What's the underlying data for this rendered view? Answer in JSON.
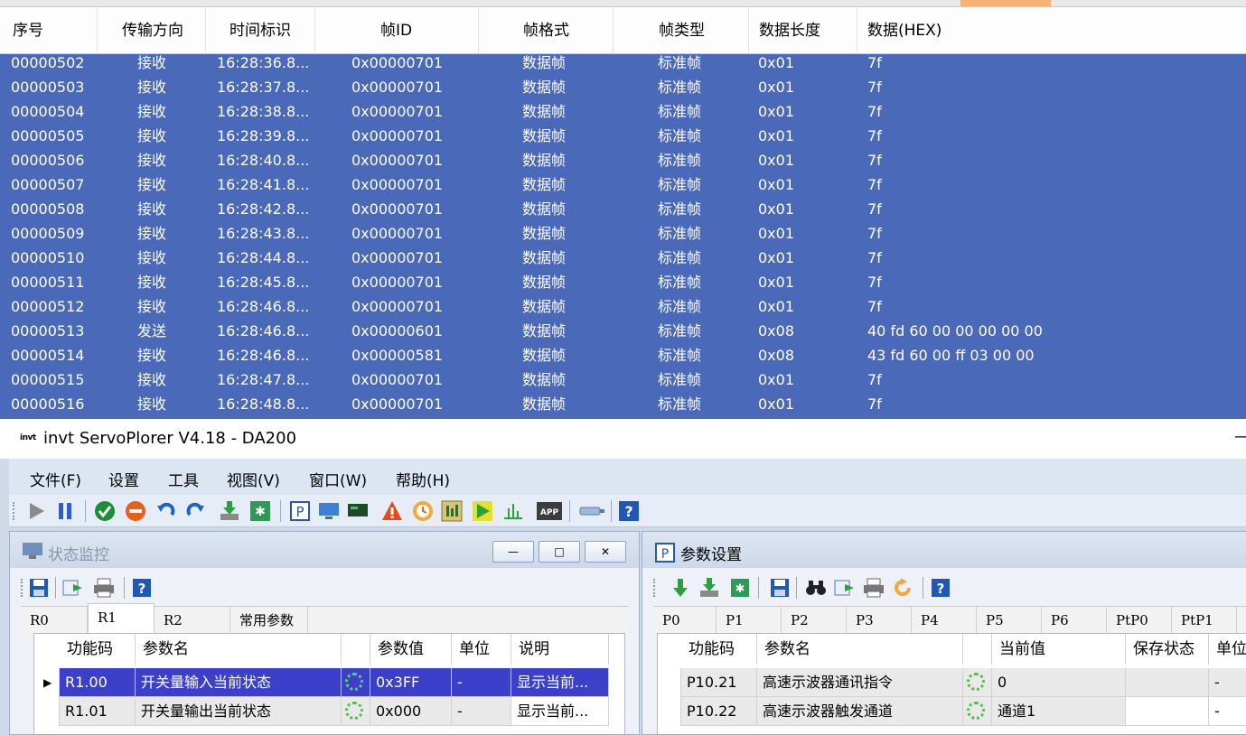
{
  "can_table": {
    "columns": [
      "序号",
      "传输方向",
      "时间标识",
      "帧ID",
      "帧格式",
      "帧类型",
      "数据长度",
      "数据(HEX)"
    ],
    "rows": [
      [
        "00000502",
        "接收",
        "16:28:36.8...",
        "0x00000701",
        "数据帧",
        "标准帧",
        "0x01",
        "7f"
      ],
      [
        "00000503",
        "接收",
        "16:28:37.8...",
        "0x00000701",
        "数据帧",
        "标准帧",
        "0x01",
        "7f"
      ],
      [
        "00000504",
        "接收",
        "16:28:38.8...",
        "0x00000701",
        "数据帧",
        "标准帧",
        "0x01",
        "7f"
      ],
      [
        "00000505",
        "接收",
        "16:28:39.8...",
        "0x00000701",
        "数据帧",
        "标准帧",
        "0x01",
        "7f"
      ],
      [
        "00000506",
        "接收",
        "16:28:40.8...",
        "0x00000701",
        "数据帧",
        "标准帧",
        "0x01",
        "7f"
      ],
      [
        "00000507",
        "接收",
        "16:28:41.8...",
        "0x00000701",
        "数据帧",
        "标准帧",
        "0x01",
        "7f"
      ],
      [
        "00000508",
        "接收",
        "16:28:42.8...",
        "0x00000701",
        "数据帧",
        "标准帧",
        "0x01",
        "7f"
      ],
      [
        "00000509",
        "接收",
        "16:28:43.8...",
        "0x00000701",
        "数据帧",
        "标准帧",
        "0x01",
        "7f"
      ],
      [
        "00000510",
        "接收",
        "16:28:44.8...",
        "0x00000701",
        "数据帧",
        "标准帧",
        "0x01",
        "7f"
      ],
      [
        "00000511",
        "接收",
        "16:28:45.8...",
        "0x00000701",
        "数据帧",
        "标准帧",
        "0x01",
        "7f"
      ],
      [
        "00000512",
        "接收",
        "16:28:46.8...",
        "0x00000701",
        "数据帧",
        "标准帧",
        "0x01",
        "7f"
      ],
      [
        "00000513",
        "发送",
        "16:28:46.8...",
        "0x00000601",
        "数据帧",
        "标准帧",
        "0x08",
        "40 fd 60 00 00 00 00 00"
      ],
      [
        "00000514",
        "接收",
        "16:28:46.8...",
        "0x00000581",
        "数据帧",
        "标准帧",
        "0x08",
        "43 fd 60 00 ff 03 00 00"
      ],
      [
        "00000515",
        "接收",
        "16:28:47.8...",
        "0x00000701",
        "数据帧",
        "标准帧",
        "0x01",
        "7f"
      ],
      [
        "00000516",
        "接收",
        "16:28:48.8...",
        "0x00000701",
        "数据帧",
        "标准帧",
        "0x01",
        "7f"
      ]
    ]
  },
  "app": {
    "logo_text": "invt",
    "title": "invt ServoPlorer V4.18 - DA200",
    "minimize_glyph": "—",
    "menu": [
      "文件(F)",
      "设置",
      "工具",
      "视图(V)",
      "窗口(W)",
      "帮助(H)"
    ],
    "toolbar_icons": [
      "play-icon",
      "pause-icon",
      "check-icon",
      "stop-icon",
      "undo-icon",
      "redo-icon",
      "download-icon",
      "reset-icon",
      "param-icon",
      "monitor-icon",
      "terminal-icon",
      "warning-icon",
      "clock-icon",
      "io-icon",
      "run-icon",
      "chart-icon",
      "app-icon",
      "connector-icon",
      "help-icon"
    ],
    "glyphs": {
      "param": "P",
      "app": "APP",
      "help": "?",
      "win_min": "—",
      "win_max": "□",
      "win_close": "✕",
      "row_pointer": "▶"
    }
  },
  "status_monitor": {
    "title": "状态监控",
    "tabs": [
      "R0",
      "R1",
      "R2",
      "常用参数"
    ],
    "active_tab": "R1",
    "columns": [
      "功能码",
      "参数名",
      "",
      "参数值",
      "单位",
      "说明"
    ],
    "rows": [
      {
        "code": "R1.00",
        "name": "开关量输入当前状态",
        "value": "0x3FF",
        "unit": "-",
        "desc": "显示当前..."
      },
      {
        "code": "R1.01",
        "name": "开关量输出当前状态",
        "value": "0x000",
        "unit": "-",
        "desc": "显示当前..."
      }
    ]
  },
  "param_settings": {
    "title": "参数设置",
    "tabs": [
      "P0",
      "P1",
      "P2",
      "P3",
      "P4",
      "P5",
      "P6",
      "PtP0",
      "PtP1"
    ],
    "columns": [
      "功能码",
      "参数名",
      "",
      "当前值",
      "保存状态",
      "单位"
    ],
    "rows": [
      {
        "code": "P10.21",
        "name": "高速示波器通讯指令",
        "value": "0",
        "save": "",
        "unit": "-"
      },
      {
        "code": "P10.22",
        "name": "高速示波器触发通道",
        "value": "通道1",
        "save": "",
        "unit": "-"
      }
    ]
  }
}
